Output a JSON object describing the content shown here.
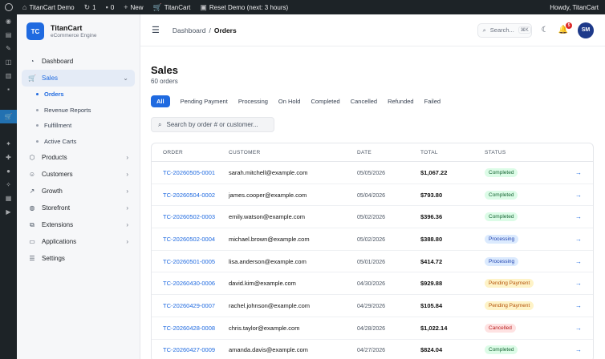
{
  "adminbar": {
    "site": "TitanCart Demo",
    "updates": "1",
    "comments": "0",
    "new": "New",
    "titancart": "TitanCart",
    "reset": "Reset Demo (next: 3 hours)",
    "howdy": "Howdy, TitanCart"
  },
  "brand": {
    "logo": "TC",
    "name": "TitanCart",
    "subtitle": "eCommerce Engine"
  },
  "nav": {
    "dashboard": "Dashboard",
    "sales": "Sales",
    "sales_sub": [
      "Orders",
      "Revenue Reports",
      "Fulfillment",
      "Active Carts"
    ],
    "products": "Products",
    "customers": "Customers",
    "growth": "Growth",
    "storefront": "Storefront",
    "extensions": "Extensions",
    "applications": "Applications",
    "settings": "Settings"
  },
  "topbar": {
    "breadcrumb_root": "Dashboard",
    "breadcrumb_sep": "/",
    "breadcrumb_current": "Orders",
    "search_placeholder": "Search...",
    "search_shortcut": "⌘K",
    "notification_count": "5",
    "avatar": "SM"
  },
  "page": {
    "title": "Sales",
    "subtitle": "60 orders",
    "search_placeholder": "Search by order # or customer..."
  },
  "filters": [
    "All",
    "Pending Payment",
    "Processing",
    "On Hold",
    "Completed",
    "Cancelled",
    "Refunded",
    "Failed"
  ],
  "table": {
    "headers": [
      "ORDER",
      "CUSTOMER",
      "DATE",
      "TOTAL",
      "STATUS"
    ],
    "rows": [
      {
        "order": "TC-20260505-0001",
        "customer": "sarah.mitchell@example.com",
        "date": "05/05/2026",
        "total": "$1,067.22",
        "status": "Completed"
      },
      {
        "order": "TC-20260504-0002",
        "customer": "james.cooper@example.com",
        "date": "05/04/2026",
        "total": "$793.80",
        "status": "Completed"
      },
      {
        "order": "TC-20260502-0003",
        "customer": "emily.watson@example.com",
        "date": "05/02/2026",
        "total": "$396.36",
        "status": "Completed"
      },
      {
        "order": "TC-20260502-0004",
        "customer": "michael.brown@example.com",
        "date": "05/02/2026",
        "total": "$388.80",
        "status": "Processing"
      },
      {
        "order": "TC-20260501-0005",
        "customer": "lisa.anderson@example.com",
        "date": "05/01/2026",
        "total": "$414.72",
        "status": "Processing"
      },
      {
        "order": "TC-20260430-0006",
        "customer": "david.kim@example.com",
        "date": "04/30/2026",
        "total": "$929.88",
        "status": "Pending Payment"
      },
      {
        "order": "TC-20260429-0007",
        "customer": "rachel.johnson@example.com",
        "date": "04/29/2026",
        "total": "$105.84",
        "status": "Pending Payment"
      },
      {
        "order": "TC-20260428-0008",
        "customer": "chris.taylor@example.com",
        "date": "04/28/2026",
        "total": "$1,022.14",
        "status": "Cancelled"
      },
      {
        "order": "TC-20260427-0009",
        "customer": "amanda.davis@example.com",
        "date": "04/27/2026",
        "total": "$824.04",
        "status": "Completed"
      }
    ]
  },
  "colors": {
    "accent": "#1f6ae0",
    "wp_dark": "#1d2327",
    "wp_active": "#2271b1"
  }
}
